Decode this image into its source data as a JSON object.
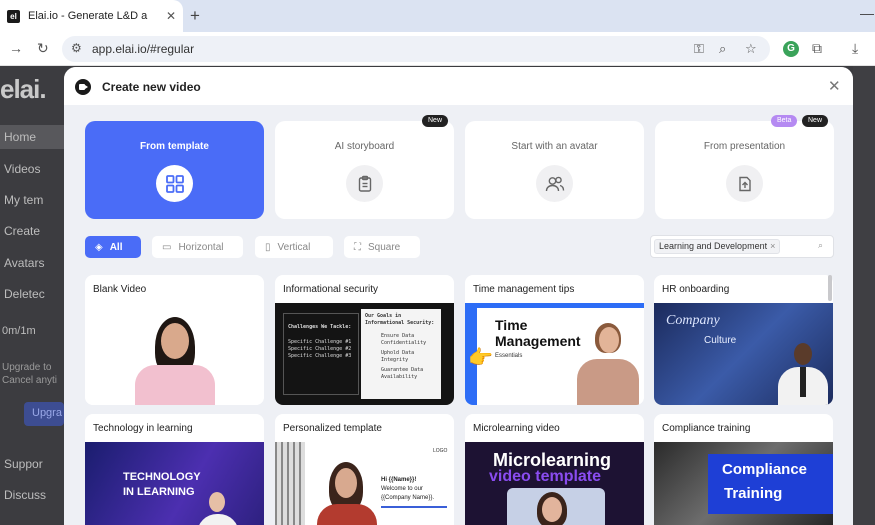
{
  "browser": {
    "tab_title": "Elai.io - Generate L&D and mar",
    "favicon_text": "el",
    "url": "app.elai.io/#regular"
  },
  "app": {
    "logo": "elai.",
    "sidebar": [
      {
        "label": "Home"
      },
      {
        "label": "Videos"
      },
      {
        "label": "My tem"
      },
      {
        "label": "Create"
      },
      {
        "label": "Avatars"
      },
      {
        "label": "Deletec"
      }
    ],
    "usage": "0m/1m",
    "upgrade_text_1": "Upgrade to",
    "upgrade_text_2": "Cancel anyti",
    "upgrade_button": "Upgra",
    "support": "Suppor",
    "discuss": "Discuss"
  },
  "modal": {
    "title": "Create new video",
    "modes": [
      {
        "label": "From template",
        "selected": true,
        "icon": "grid-icon"
      },
      {
        "label": "AI storyboard",
        "badge": "New",
        "icon": "clipboard-icon"
      },
      {
        "label": "Start with an avatar",
        "icon": "users-icon"
      },
      {
        "label": "From presentation",
        "badges": [
          "Beta",
          "New"
        ],
        "icon": "upload-icon"
      }
    ],
    "filters": [
      {
        "label": "All",
        "selected": true
      },
      {
        "label": "Horizontal"
      },
      {
        "label": "Vertical"
      },
      {
        "label": "Square"
      }
    ],
    "search_tag": "Learning and Development",
    "templates": [
      {
        "title": "Blank Video"
      },
      {
        "title": "Informational security",
        "thumb": {
          "left_heading": "Challenges We Tackle:",
          "left_items": [
            "Specific Challenge #1",
            "Specific Challenge #2",
            "Specific Challenge #3"
          ],
          "right_heading": "Our Goals in Informational Security:",
          "right_items": [
            "Ensure Data Confidentiality",
            "Uphold Data Integrity",
            "Guarantee Data Availability"
          ]
        }
      },
      {
        "title": "Time management tips",
        "thumb": {
          "heading_1": "Time",
          "heading_2": "Management",
          "sub": "Essentials"
        }
      },
      {
        "title": "HR onboarding",
        "thumb": {
          "word_1": "Company",
          "word_2": "Culture"
        }
      },
      {
        "title": "Technology in learning",
        "thumb": {
          "line_1": "TECHNOLOGY",
          "line_2": "IN LEARNING"
        }
      },
      {
        "title": "Personalized template",
        "thumb": {
          "logo": "LOGO",
          "line_1": "Hi {{Name}}!",
          "line_2": "Welcome to our",
          "line_3": "{{Company Name}}."
        }
      },
      {
        "title": "Microlearning video",
        "thumb": {
          "line_1": "Microlearning",
          "line_2": "video template"
        }
      },
      {
        "title": "Compliance training",
        "thumb": {
          "line_1": "Compliance",
          "line_2": "Training"
        }
      }
    ]
  },
  "colors": {
    "accent": "#4a6cf7",
    "badge_new": "#222222",
    "badge_beta": "#b58af2"
  }
}
